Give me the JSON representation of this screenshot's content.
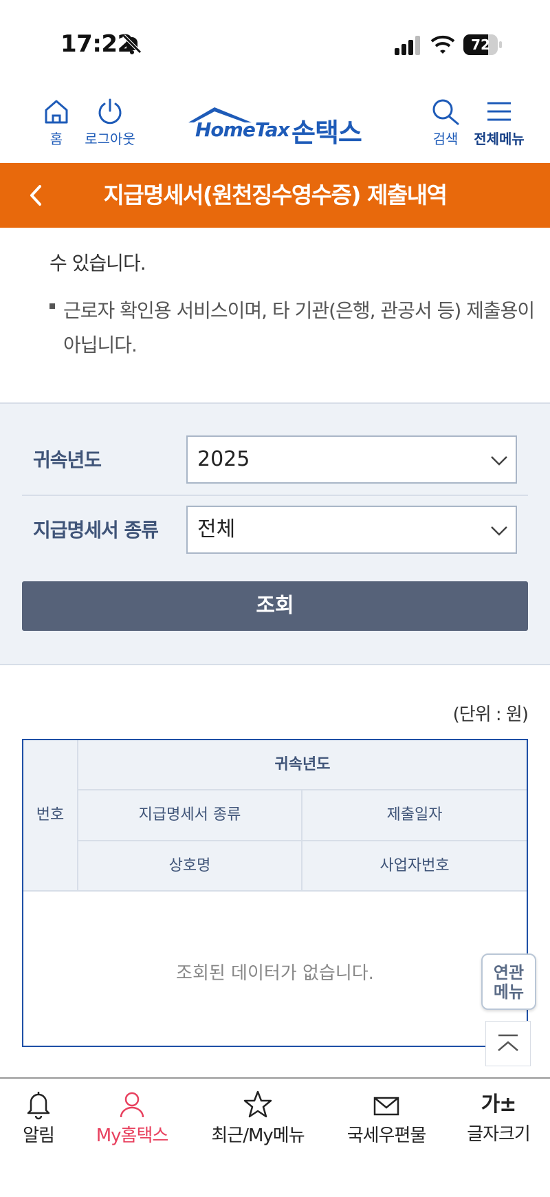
{
  "status_bar": {
    "time": "17:22",
    "battery": "72",
    "battery_level": 0.72
  },
  "header": {
    "home_label": "홈",
    "logout_label": "로그아웃",
    "logo_en": "HomeTax",
    "logo_ko": "손택스",
    "search_label": "검색",
    "menu_label": "전체메뉴"
  },
  "title_bar": {
    "title": "지급명세서(원천징수영수증) 제출내역"
  },
  "info": {
    "line1": "수 있습니다.",
    "line2": "근로자 확인용 서비스이며, 타 기관(은행, 관공서 등) 제출용이 아닙니다."
  },
  "search": {
    "year_label": "귀속년도",
    "year_value": "2025",
    "type_label": "지급명세서 종류",
    "type_value": "전체",
    "search_button": "조회"
  },
  "results": {
    "unit": "(단위 : 원)",
    "headers": {
      "number": "번호",
      "year": "귀속년도",
      "type": "지급명세서 종류",
      "date": "제출일자",
      "company": "상호명",
      "biz_no": "사업자번호"
    },
    "empty_message": "조회된 데이터가 없습니다."
  },
  "floating": {
    "related_line1": "연관",
    "related_line2": "메뉴"
  },
  "bottom_nav": {
    "items": [
      {
        "label": "알림",
        "icon": "bell-icon"
      },
      {
        "label": "My홈택스",
        "icon": "person-icon"
      },
      {
        "label": "최근/My메뉴",
        "icon": "star-icon"
      },
      {
        "label": "국세우편물",
        "icon": "mail-icon"
      },
      {
        "label": "글자크기",
        "icon": "font-size-icon"
      }
    ],
    "icon_font": "가±"
  },
  "colors": {
    "brand_blue": "#1e5bb8",
    "orange": "#e8690c",
    "active_pink": "#e8405e",
    "button_gray": "#566279"
  }
}
